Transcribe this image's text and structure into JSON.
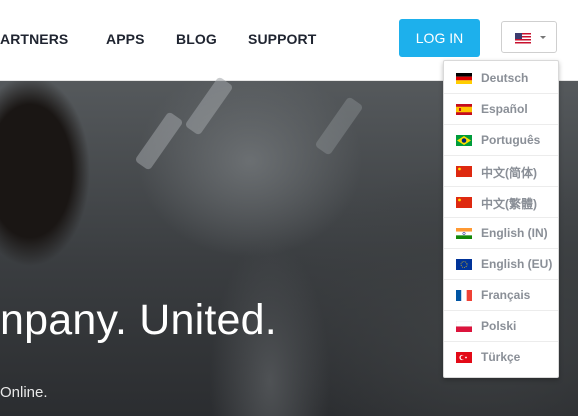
{
  "nav": {
    "items": [
      {
        "id": "partners",
        "label": "ARTNERS"
      },
      {
        "id": "apps",
        "label": "APPS"
      },
      {
        "id": "blog",
        "label": "BLOG"
      },
      {
        "id": "support",
        "label": "SUPPORT"
      }
    ],
    "login_label": "LOG IN",
    "language_selector": {
      "current_flag": "us-flag-icon"
    }
  },
  "hero": {
    "headline": "npany. United.",
    "subline": "Online."
  },
  "language_menu": {
    "items": [
      {
        "label": "Deutsch",
        "flag": "germany-flag-icon"
      },
      {
        "label": "Español",
        "flag": "spain-flag-icon"
      },
      {
        "label": "Português",
        "flag": "brazil-flag-icon"
      },
      {
        "label": "中文(简体)",
        "flag": "china-flag-icon"
      },
      {
        "label": "中文(繁體)",
        "flag": "china-flag-icon"
      },
      {
        "label": "English (IN)",
        "flag": "india-flag-icon"
      },
      {
        "label": "English (EU)",
        "flag": "eu-flag-icon"
      },
      {
        "label": "Français",
        "flag": "france-flag-icon"
      },
      {
        "label": "Polski",
        "flag": "poland-flag-icon"
      },
      {
        "label": "Türkçe",
        "flag": "turkey-flag-icon"
      }
    ]
  },
  "colors": {
    "login_button": "#1db0ec",
    "nav_text": "#1f2430",
    "menu_text": "#8a8f97"
  }
}
